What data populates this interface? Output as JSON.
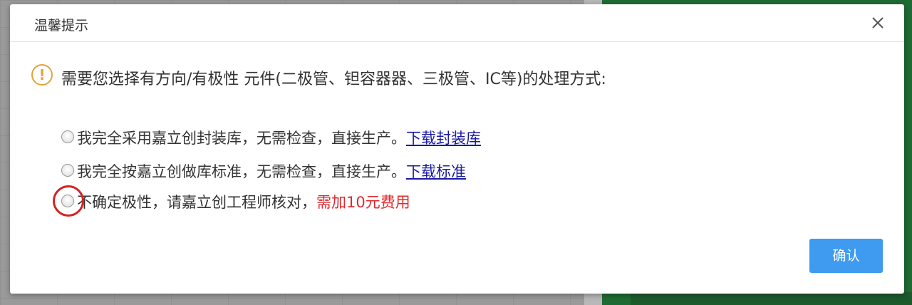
{
  "dialog": {
    "title": "温馨提示",
    "question": "需要您选择有方向/有极性 元件(二极管、钽容器器、三极管、IC等)的处理方式:",
    "options": [
      {
        "text": "我完全采用嘉立创封装库，无需检查，直接生产。",
        "link": "下载封装库"
      },
      {
        "text": "我完全按嘉立创做库标准，无需检查，直接生产。",
        "link": "下载标准"
      },
      {
        "text": "不确定极性，请嘉立创工程师核对，",
        "fee": "需加10元费用"
      }
    ],
    "confirm_label": "确认"
  },
  "colors": {
    "warning": "#e6a23c",
    "link": "#1a1aa6",
    "fee": "#e0282d",
    "primary_button": "#3f9bf0",
    "highlight_circle": "#d42222"
  },
  "icons": {
    "warning": "exclamation-circle-icon",
    "close": "close-x-icon"
  }
}
